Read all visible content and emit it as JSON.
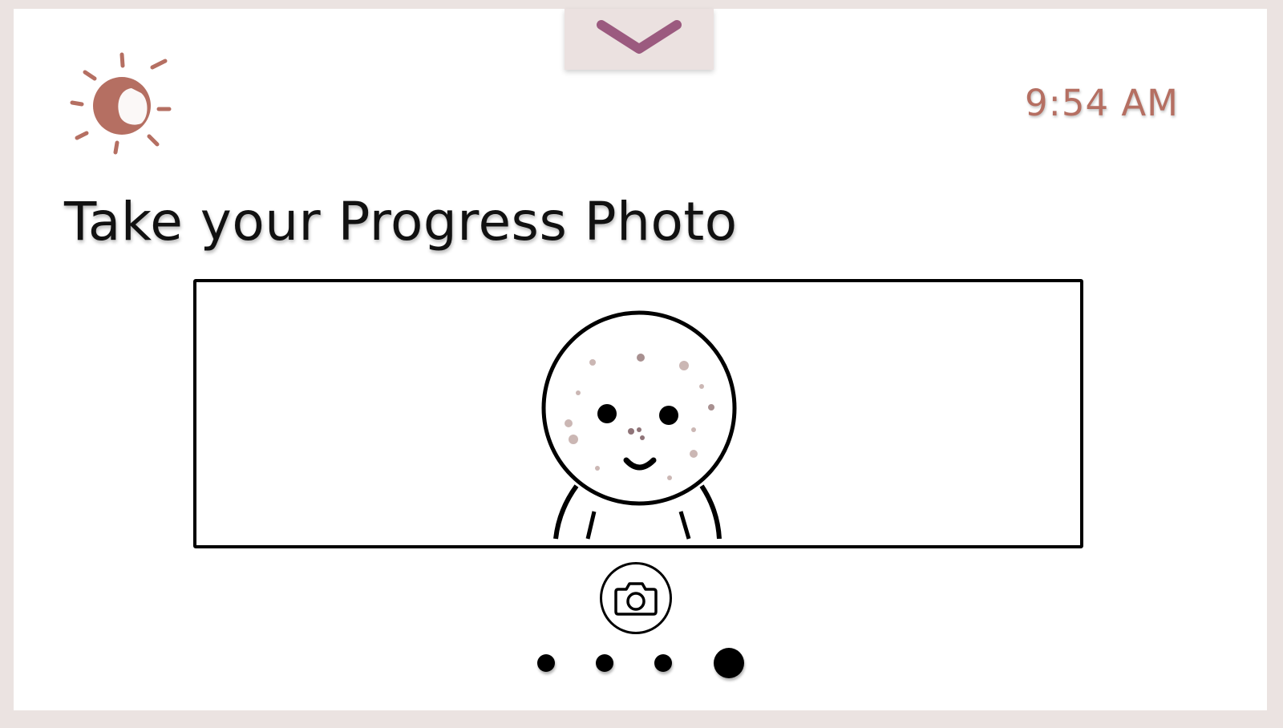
{
  "header": {
    "time": "9:54 AM",
    "pull_tab_icon": "chevron-down-icon",
    "weather_icon": "sun-icon"
  },
  "main": {
    "title": "Take your Progress Photo",
    "preview_icon": "face-avatar-icon",
    "capture_icon": "camera-icon"
  },
  "pagination": {
    "total": 4,
    "current": 4
  },
  "colors": {
    "background": "#ebe3e1",
    "accent_chevron": "#9b5a7f",
    "sun": "#b56f62",
    "time_text": "#b56f62"
  }
}
